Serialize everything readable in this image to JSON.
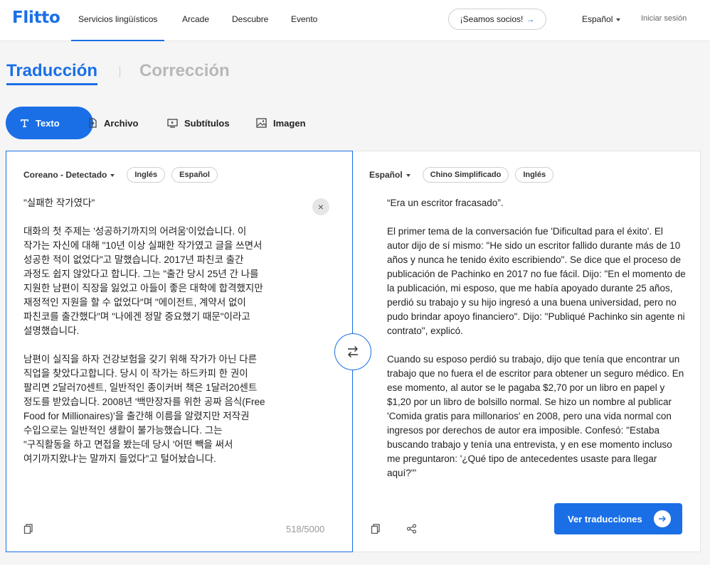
{
  "brand": {
    "logo": "Flitto"
  },
  "nav": {
    "items": [
      "Servicios lingüísticos",
      "Arcade",
      "Descubre",
      "Evento"
    ],
    "partners": "¡Seamos socios!",
    "partners_arrow": "→",
    "language": "Español",
    "login": "Iniciar sesión"
  },
  "tabs": {
    "translate": "Traducción",
    "correct": "Corrección"
  },
  "types": [
    "Texto",
    "Archivo",
    "Subtítulos",
    "Imagen"
  ],
  "source": {
    "lang": "Coreano - Detectado",
    "chips": [
      "Inglés",
      "Español"
    ],
    "paragraphs": [
      "\"실패한 작가였다\"",
      "대화의 첫 주제는 '성공하기까지의 어려움'이었습니다. 이\n작가는 자신에 대해 \"10년 이상 실패한 작가였고 글을 쓰면서\n성공한 적이 없었다\"고 말했습니다. 2017년 파친코 출간\n과정도 쉽지 않았다고 합니다. 그는 \"출간 당시 25년 간 나를\n지원한 남편이 직장을 잃었고 아들이 좋은 대학에 합격했지만\n재정적인 지원을 할 수 없었다\"며 \"에이전트, 계약서 없이\n파친코를 출간했다\"며 \"나에겐 정말 중요했기 때문\"이라고\n설명했습니다.",
      "남편이 실직을 하자 건강보험을 갖기 위해 작가가 아닌 다른\n직업을 찾았다고합니다. 당시 이 작가는 하드카피 한 권이\n팔리면 2달러70센트, 일반적인 종이커버 책은 1달러20센트\n정도를 받았습니다. 2008년 '백만장자를 위한 공짜 음식(Free\nFood for Millionaires)'을 출간해 이름을 알렸지만 저작권\n수입으로는 일반적인 생활이 불가능했습니다. 그는\n\"구직활동을 하고 면접을 봤는데 당시 '어떤 빽을 써서\n여기까지왔냐'는 말까지 들었다\"고 털어놨습니다."
    ],
    "counter": "518/5000",
    "clear": "×"
  },
  "target": {
    "lang": "Español",
    "chips": [
      "Chino Simplificado",
      "Inglés"
    ],
    "paragraphs": [
      "“Era un escritor fracasado”.",
      "El primer tema de la conversación fue 'Dificultad para el éxito'. El autor dijo de sí mismo: \"He sido un escritor fallido durante más de 10 años y nunca he tenido éxito escribiendo\". Se dice que el proceso de publicación de Pachinko en 2017 no fue fácil. Dijo: \"En el momento de la publicación, mi esposo, que me había apoyado durante 25 años, perdió su trabajo y su hijo ingresó a una buena universidad, pero no pudo brindar apoyo financiero\". Dijo: \"Publiqué Pachinko sin agente ni contrato\", explicó.",
      "Cuando su esposo perdió su trabajo, dijo que tenía que encontrar un trabajo que no fuera el de escritor para obtener un seguro médico. En ese momento, al autor se le pagaba $2,70 por un libro en papel y $1,20 por un libro de bolsillo normal. Se hizo un nombre al publicar 'Comida gratis para millonarios' en 2008, pero una vida normal con ingresos por derechos de autor era imposible. Confesó: \"Estaba buscando trabajo y tenía una entrevista, y en ese momento incluso me preguntaron: '¿Qué tipo de antecedentes usaste para llegar aquí?'\""
    ],
    "view_button": "Ver traducciones"
  },
  "colors": {
    "accent": "#1a6fe6"
  },
  "icons": [
    "text-icon",
    "file-icon",
    "subtitles-icon",
    "image-icon",
    "swap-icon",
    "copy-icon",
    "share-icon",
    "arrow-right-icon",
    "clear-icon"
  ]
}
